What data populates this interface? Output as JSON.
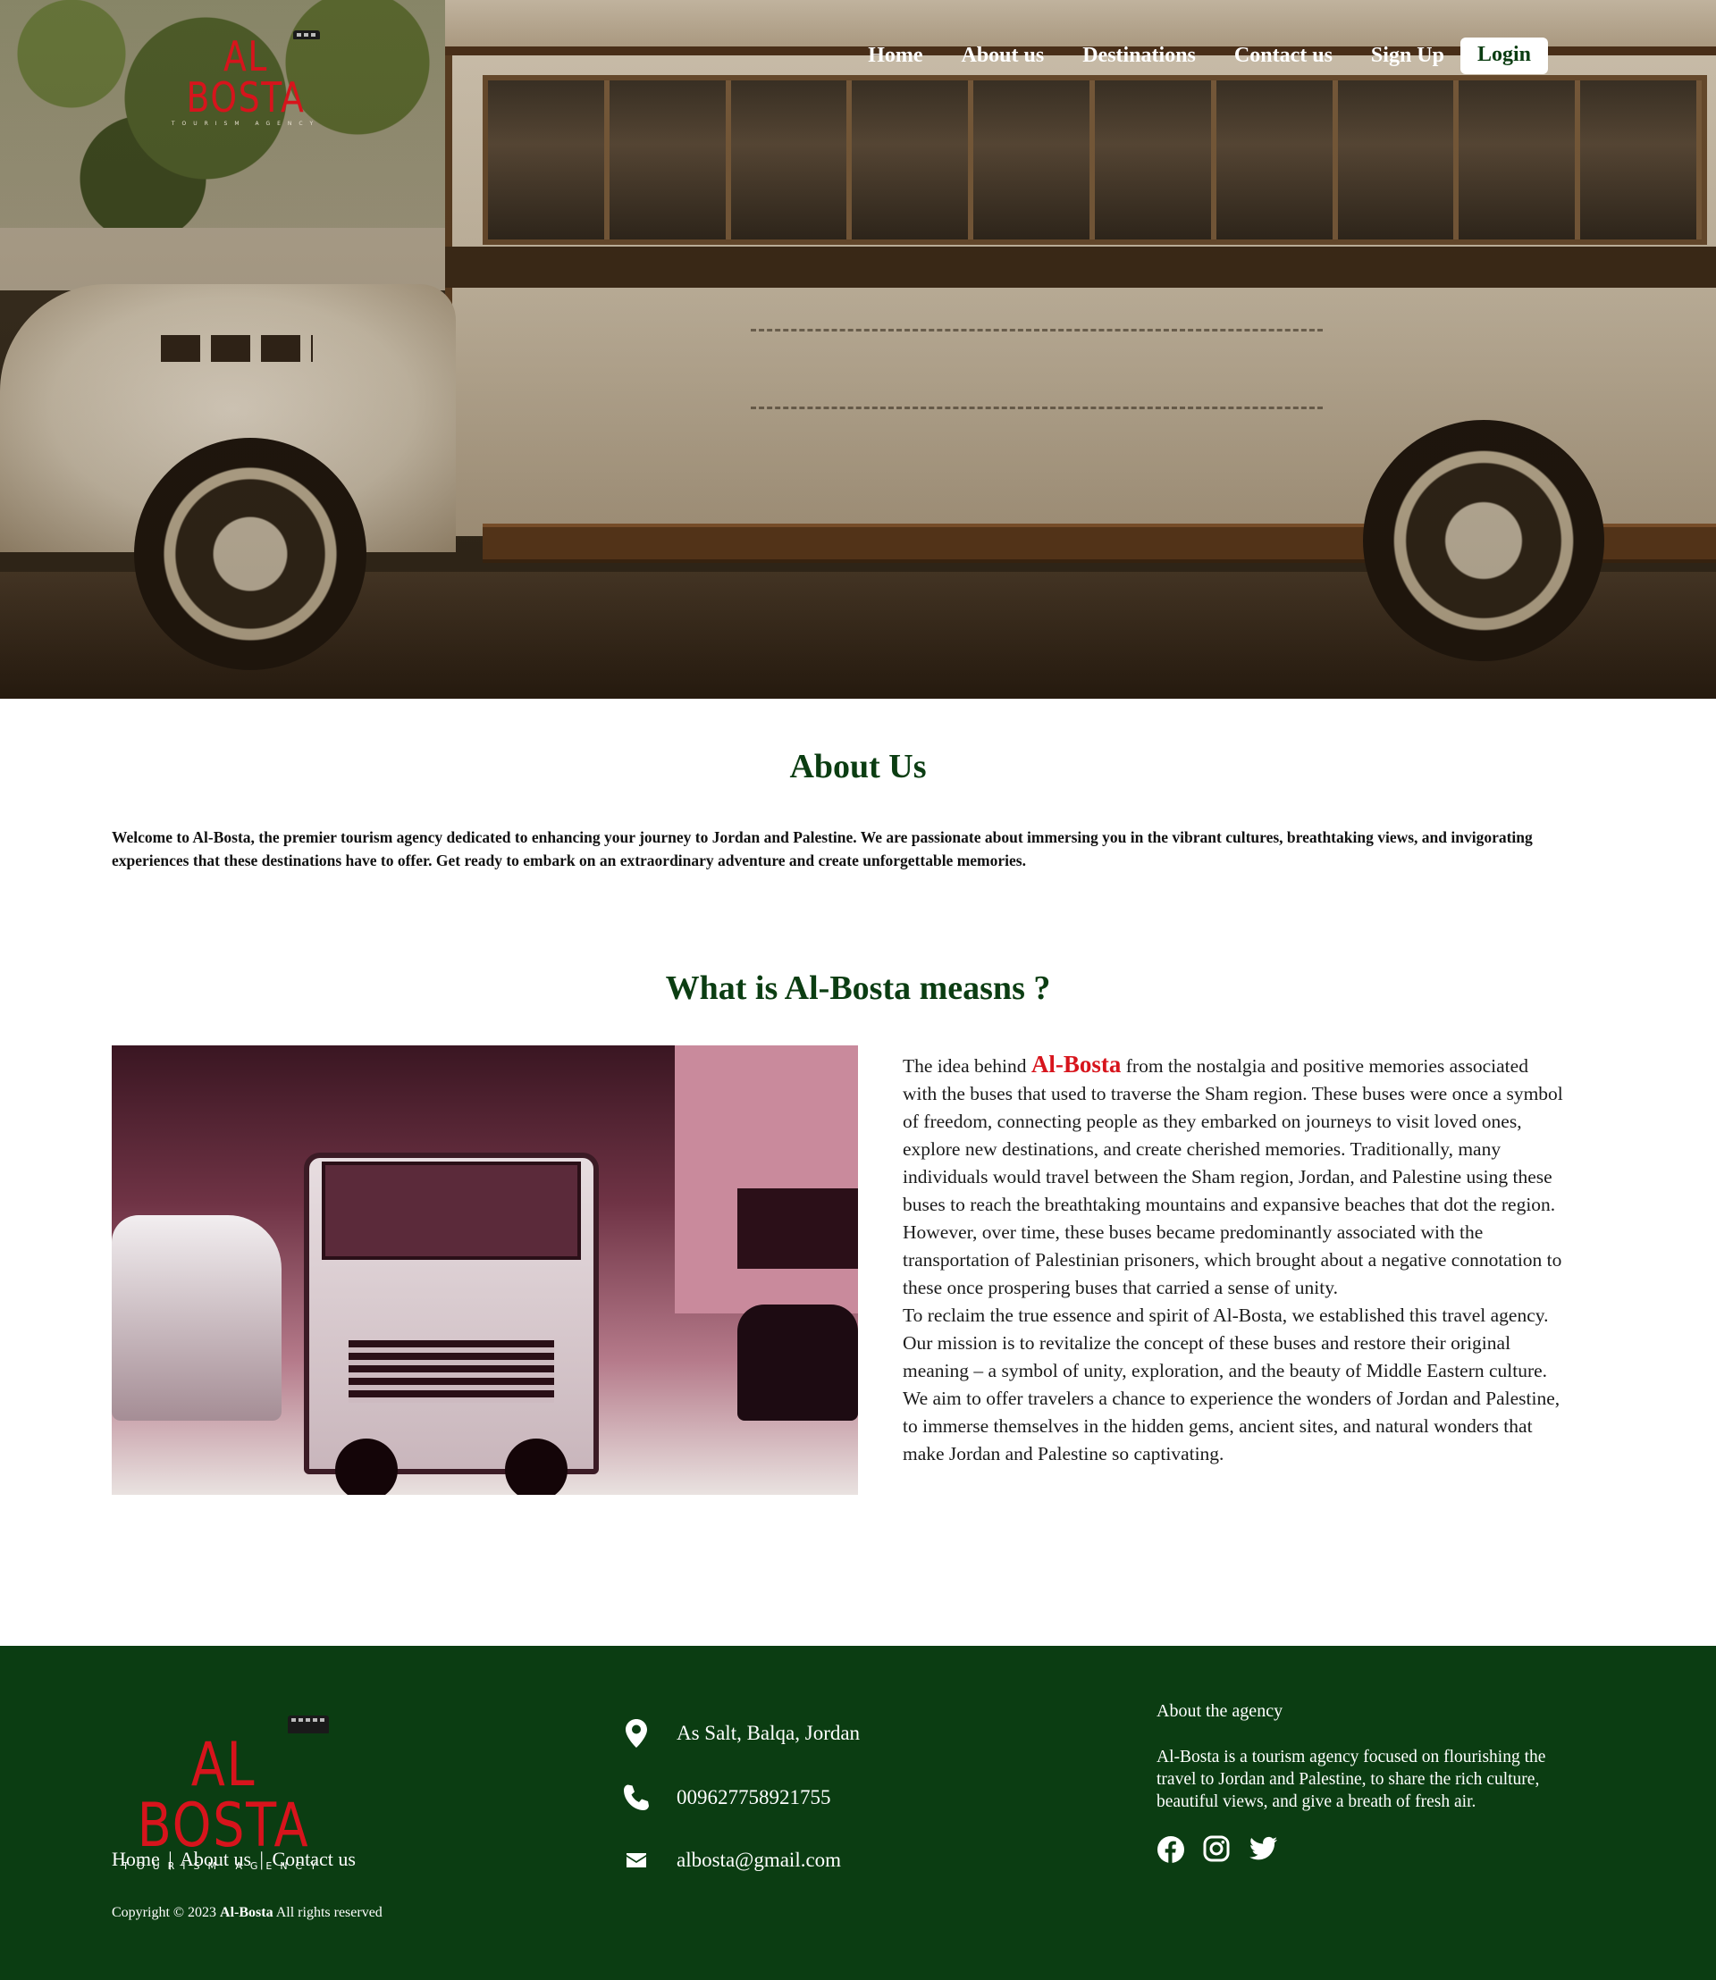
{
  "brand": {
    "logo_word": "AL BOSTA",
    "logo_tag": "TOURISM AGENCY",
    "accent_color": "#d7141c",
    "primary_green": "#0b3d12"
  },
  "nav": {
    "items": [
      "Home",
      "About us",
      "Destinations",
      "Contact us",
      "Sign Up"
    ],
    "login_label": "Login"
  },
  "hero": {
    "image": "vintage-bus-photo"
  },
  "about": {
    "title": "About Us",
    "text": "Welcome to Al-Bosta, the premier tourism agency dedicated to enhancing your journey to Jordan and Palestine. We are passionate about immersing you in the vibrant cultures, breathtaking views, and invigorating experiences that these destinations have to offer. Get ready to embark on an extraordinary adventure and create unforgettable memories."
  },
  "meaning": {
    "title": "What is Al-Bosta measns ?",
    "image": "old-truck-photo",
    "intro": "The idea behind ",
    "brand_word": "Al-Bosta",
    "para1": " from the nostalgia and positive memories associated with the buses that used to traverse the Sham region. These buses were once a symbol of freedom, connecting people as they embarked on journeys to visit loved ones, explore new destinations, and create cherished memories. Traditionally, many individuals would travel between the Sham region, Jordan, and Palestine using these buses to reach the breathtaking mountains and expansive beaches that dot the region. However, over time, these buses became predominantly associated with the transportation of Palestinian prisoners, which brought about a negative connotation to these once prospering buses that carried a sense of unity.",
    "para2": "To reclaim the true essence and spirit of Al-Bosta, we established this travel agency. Our mission is to revitalize the concept of these buses and restore their original meaning – a symbol of unity, exploration, and the beauty of Middle Eastern culture. We aim to offer travelers a chance to experience the wonders of Jordan and Palestine, to immerse themselves in the hidden gems, ancient sites, and natural wonders that make Jordan and Palestine so captivating."
  },
  "footer": {
    "links": [
      "Home",
      "About us",
      "Contact us"
    ],
    "link_separator": "|",
    "copyright_prefix": "Copyright © 2023 ",
    "copyright_brand": "Al-Bosta",
    "copyright_suffix": " All rights reserved",
    "contact": {
      "address": "As Salt, Balqa, Jordan",
      "phone": "009627758921755",
      "email": "albosta@gmail.com",
      "address_icon": "location-pin-icon",
      "phone_icon": "phone-icon",
      "email_icon": "envelope-icon"
    },
    "agency_title": "About the agency",
    "agency_text": "Al-Bosta is a tourism agency focused on flourishing the travel to Jordan and Palestine, to share the rich culture, beautiful views, and give a breath of fresh air.",
    "socials": [
      "facebook-icon",
      "instagram-icon",
      "twitter-icon"
    ]
  }
}
